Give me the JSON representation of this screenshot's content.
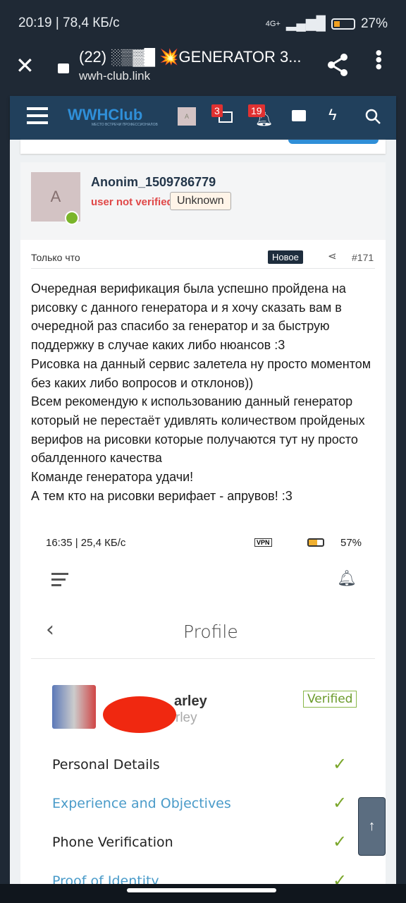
{
  "status_bar": {
    "time": "20:19 | 78,4 КБ/с",
    "network": "4G+",
    "battery": "27%"
  },
  "browser": {
    "title": "(22) ░▒▓█ 💥GENERATOR 3...",
    "url": "wwh-club.link"
  },
  "forum_nav": {
    "logo": "WWHClub",
    "logo_tagline": "МЕСТО ВСТРЕЧИ ПРОФЕССИОНАЛОВ",
    "avatar_letter": "A",
    "messages_count": "3",
    "alerts_count": "19"
  },
  "post": {
    "username": "Anonim_1509786779",
    "status": "user not verified",
    "role_badge": "Unknown",
    "avatar_letter": "A",
    "time": "Только что",
    "new_label": "Новое",
    "number": "#171",
    "body": [
      "Очередная верификация была успешно пройдена на рисовку с данного генератора и я хочу сказать вам в очередной раз спасибо за генератор и за быструю поддержку в случае каких либо нюансов :3",
      "Рисовка на данный сервис залетела ну просто моментом без каких либо вопросов и отклонов))",
      "Всем рекомендую к использованию данный генератор который не перестаёт удивлять количеством пройденых верифов на рисовки которые получаются тут ну просто обалденного качества",
      "Команде генератора удачи!",
      "А тем кто на рисовки верифает - апрувов! :3"
    ]
  },
  "embedded": {
    "status_time": "16:35 | 25,4 КБ/с",
    "vpn": "VPN",
    "battery": "57%",
    "title": "Profile",
    "name_visible": "arley",
    "sub_visible": "rley",
    "verified": "Verified",
    "items": [
      {
        "label": "Personal Details",
        "link": false
      },
      {
        "label": "Experience and Objectives",
        "link": true
      },
      {
        "label": "Phone Verification",
        "link": false
      },
      {
        "label": "Proof of Identity",
        "link": true
      }
    ]
  },
  "colors": {
    "accent": "#2f8fd8",
    "error": "#e04848",
    "check": "#7aa62a",
    "link": "#4a9bc9"
  }
}
